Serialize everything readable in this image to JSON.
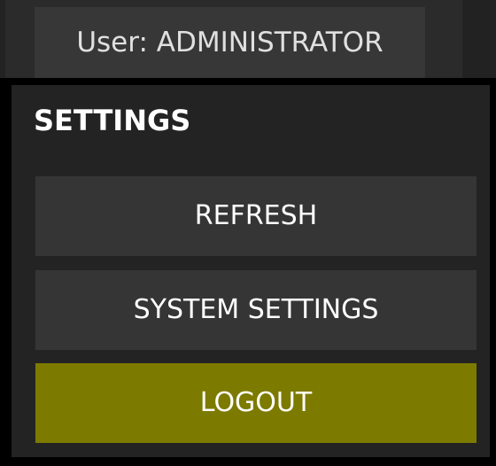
{
  "header": {
    "user_label": "User: ADMINISTRATOR"
  },
  "settings": {
    "title": "SETTINGS",
    "buttons": {
      "refresh": "REFRESH",
      "system_settings": "SYSTEM SETTINGS",
      "logout": "LOGOUT"
    }
  },
  "colors": {
    "panel_background": "#232323",
    "button_background": "#353535",
    "logout_accent": "#7d7a00",
    "text": "#ffffff"
  }
}
